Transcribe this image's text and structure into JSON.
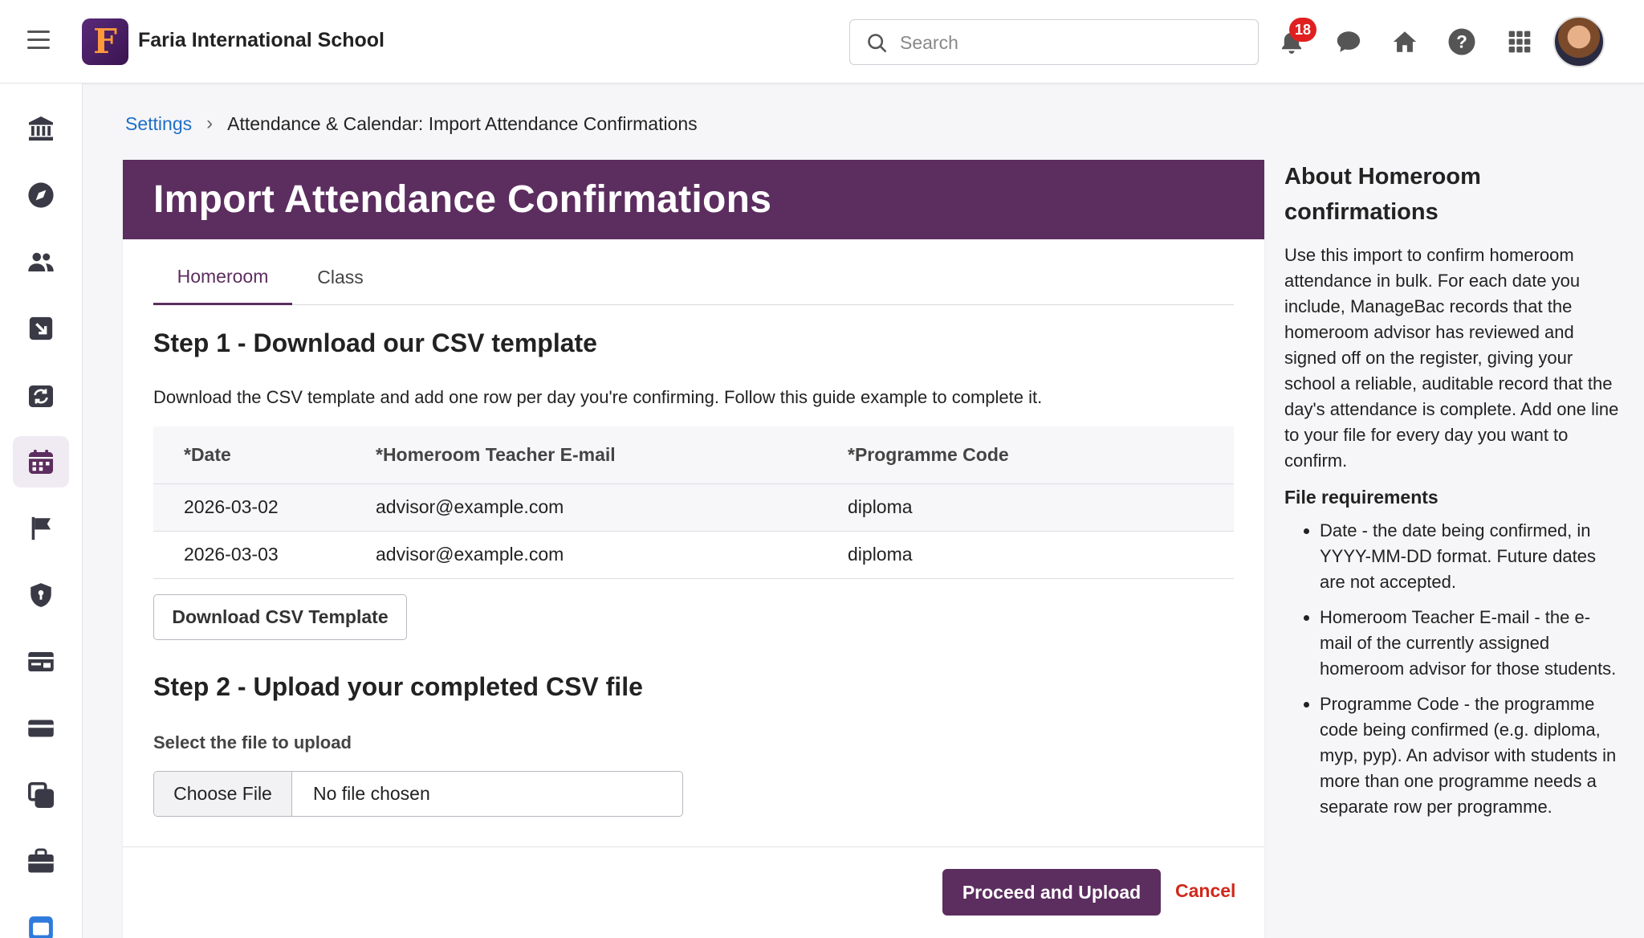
{
  "header": {
    "school_name": "Faria International School",
    "logo_letter": "F",
    "search_placeholder": "Search",
    "notification_count": "18"
  },
  "breadcrumb": {
    "root": "Settings",
    "current": "Attendance & Calendar: Import Attendance Confirmations"
  },
  "page": {
    "title": "Import Attendance Confirmations",
    "tabs": [
      {
        "label": "Homeroom",
        "active": true
      },
      {
        "label": "Class",
        "active": false
      }
    ]
  },
  "step1": {
    "title": "Step 1 - Download our CSV template",
    "description": "Download the CSV template and add one row per day you're confirming. Follow this guide example to complete it.",
    "table": {
      "headers": [
        "*Date",
        "*Homeroom Teacher E-mail",
        "*Programme Code"
      ],
      "rows": [
        [
          "2026-03-02",
          "advisor@example.com",
          "diploma"
        ],
        [
          "2026-03-03",
          "advisor@example.com",
          "diploma"
        ]
      ]
    },
    "download_label": "Download CSV Template"
  },
  "step2": {
    "title": "Step 2 - Upload your completed CSV file",
    "file_label": "Select the file to upload",
    "choose_label": "Choose File",
    "file_status": "No file chosen"
  },
  "footer": {
    "proceed_label": "Proceed and Upload",
    "cancel_label": "Cancel"
  },
  "help": {
    "title": "About Homeroom confirmations",
    "intro": "Use this import to confirm homeroom attendance in bulk. For each date you include, ManageBac records that the homeroom advisor has reviewed and signed off on the register, giving your school a reliable, auditable record that the day's attendance is complete. Add one line to your file for every day you want to confirm.",
    "requirements_title": "File requirements",
    "requirements": [
      "Date - the date being confirmed, in YYYY-MM-DD format. Future dates are not accepted.",
      "Homeroom Teacher E-mail - the e-mail of the currently assigned homeroom advisor for those students.",
      "Programme Code - the programme code being confirmed (e.g. diploma, myp, pyp). An advisor with students in more than one programme needs a separate row per programme."
    ]
  },
  "colors": {
    "brand_purple": "#5c2d5f",
    "link_blue": "#1f6fc5",
    "cancel_red": "#d0281b",
    "badge_red": "#e02020"
  },
  "icons": {
    "topbar": [
      "menu-icon",
      "search-icon",
      "bell-icon",
      "chat-icon",
      "home-icon",
      "help-icon",
      "apps-grid-icon"
    ],
    "sidebar": [
      "school-building-icon",
      "compass-icon",
      "users-icon",
      "import-arrow-icon",
      "sync-calendar-icon",
      "calendar-icon",
      "flag-icon",
      "shield-icon",
      "id-card-icon",
      "card-icon",
      "copy-icon",
      "briefcase-icon",
      "dp-app-icon"
    ]
  }
}
